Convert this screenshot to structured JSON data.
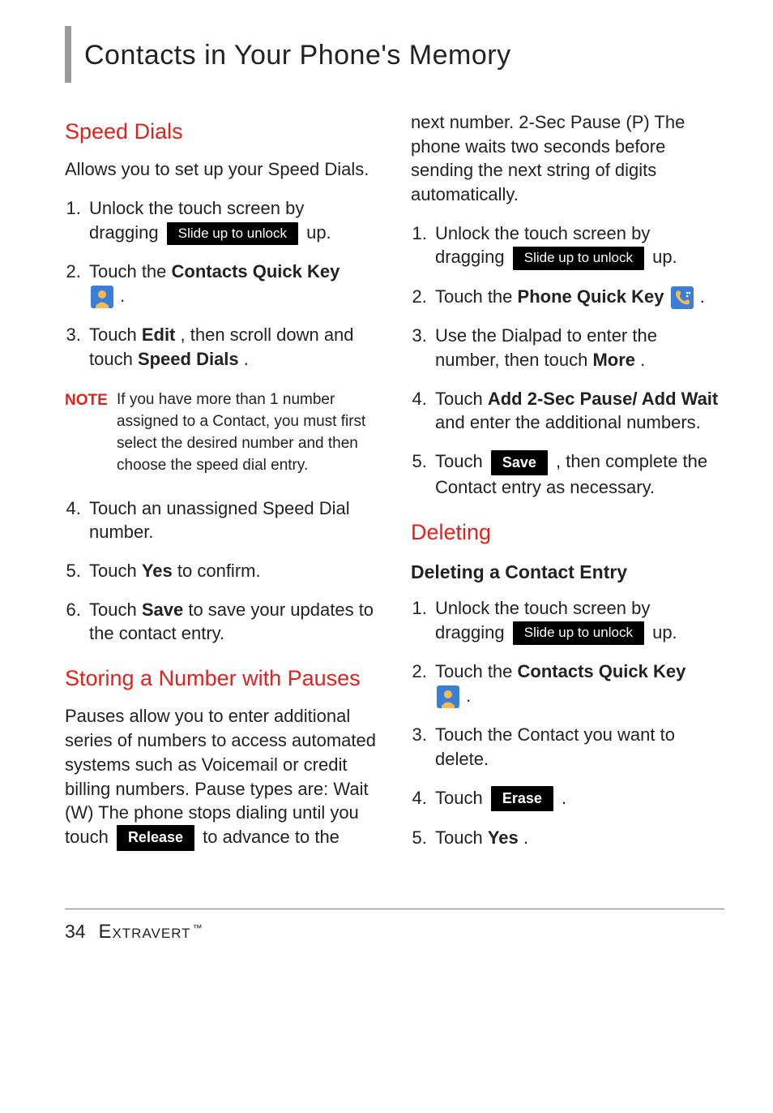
{
  "header": {
    "title": "Contacts in Your Phone's Memory"
  },
  "footer": {
    "page": "34",
    "brand": "Extravert",
    "tm": "™"
  },
  "labels": {
    "slide_unlock": "Slide up to unlock",
    "save": "Save",
    "erase": "Erase",
    "release": "Release",
    "note": "NOTE"
  },
  "icons": {
    "contacts": "contacts-icon",
    "phone": "phone-icon"
  },
  "left": {
    "speed_dials": {
      "heading": "Speed Dials",
      "intro": "Allows you to set up your Speed Dials.",
      "step1_pre": "Unlock the touch screen by dragging ",
      "step1_post": " up.",
      "step2_pre": "Touch the ",
      "step2_bold": "Contacts Quick Key",
      "step2_post": ".",
      "step3_pre": "Touch ",
      "step3_b1": "Edit",
      "step3_mid": ", then scroll down and touch ",
      "step3_b2": "Speed Dials",
      "step3_post": ".",
      "note_body": "If you have more than 1 number assigned to a Contact, you must first select the desired number and then choose the speed dial entry.",
      "step4": "Touch an unassigned Speed Dial number.",
      "step5_pre": "Touch ",
      "step5_b": "Yes",
      "step5_post": " to confirm.",
      "step6_pre": "Touch ",
      "step6_b": "Save",
      "step6_post": " to save your updates to the contact entry."
    },
    "pauses": {
      "heading": "Storing a Number with Pauses",
      "intro_a": "Pauses allow you to enter additional series of numbers to access automated systems such as Voicemail or credit billing numbers. Pause types are: Wait (W) The phone stops dialing until you touch ",
      "intro_b": " to advance to the "
    }
  },
  "right": {
    "pauses_cont": "next number. 2-Sec Pause (P) The phone waits two seconds before sending the next string of digits automatically.",
    "p_step1_pre": "Unlock the touch screen by dragging ",
    "p_step1_post": " up.",
    "p_step2_pre": "Touch the ",
    "p_step2_bold": "Phone Quick Key",
    "p_step2_post": ".",
    "p_step3_pre": "Use the Dialpad to enter the number, then touch ",
    "p_step3_b": "More",
    "p_step3_post": ".",
    "p_step4_pre": "Touch ",
    "p_step4_b": "Add 2-Sec Pause/ Add Wait",
    "p_step4_post": " and enter the additional numbers.",
    "p_step5_pre": "Touch ",
    "p_step5_post": " , then complete the Contact entry as necessary.",
    "deleting": {
      "heading": "Deleting",
      "subhead": "Deleting a Contact Entry",
      "d_step1_pre": "Unlock the touch screen by dragging ",
      "d_step1_post": " up.",
      "d_step2_pre": "Touch the ",
      "d_step2_bold": "Contacts Quick Key",
      "d_step2_post": ".",
      "d_step3": "Touch the Contact you want to delete.",
      "d_step4_pre": "Touch ",
      "d_step4_post": " .",
      "d_step5_pre": "Touch ",
      "d_step5_b": "Yes",
      "d_step5_post": "."
    }
  }
}
